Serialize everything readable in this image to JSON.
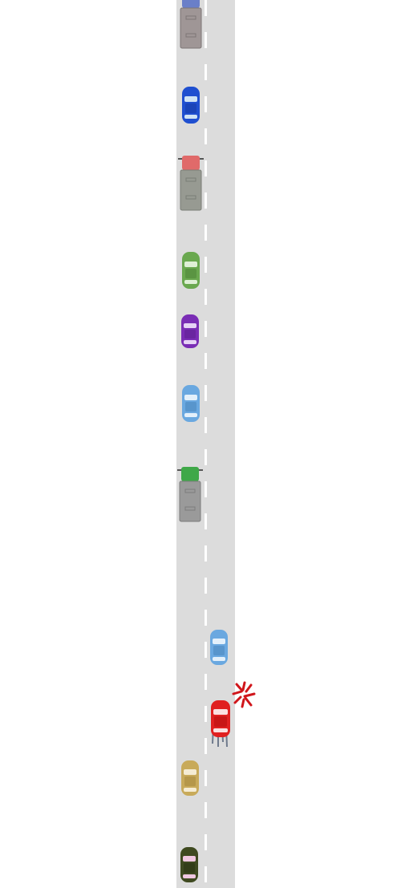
{
  "scene": {
    "road_color": "#dcdcdc",
    "lane_marking_color": "#ffffff",
    "background_color": "#ffffff"
  },
  "vehicles": [
    {
      "kind": "truck",
      "cab_color": "#6a7fc8",
      "cargo_color": "#9f9696",
      "lane": "left"
    },
    {
      "kind": "car",
      "color": "#1f4fd0",
      "lane": "left"
    },
    {
      "kind": "truck",
      "cab_color": "#e06a6a",
      "cargo_color": "#979a92",
      "lane": "left"
    },
    {
      "kind": "car",
      "color": "#6aa84f",
      "lane": "left"
    },
    {
      "kind": "car",
      "color": "#7a2db5",
      "lane": "left"
    },
    {
      "kind": "car",
      "color": "#6aa8e0",
      "lane": "left"
    },
    {
      "kind": "truck",
      "cab_color": "#3fa848",
      "cargo_color": "#9a9a9a",
      "lane": "left"
    },
    {
      "kind": "car",
      "color": "#6aa8e0",
      "lane": "right"
    },
    {
      "kind": "car",
      "color": "#e02020",
      "lane": "right",
      "role": "player"
    },
    {
      "kind": "car",
      "color": "#c8aa5a",
      "lane": "left"
    },
    {
      "kind": "car",
      "color": "#3f4a20",
      "lane": "left"
    }
  ],
  "effects": {
    "collision_mark_color": "#d0161b",
    "skid_mark_color": "#6f7a8c"
  }
}
